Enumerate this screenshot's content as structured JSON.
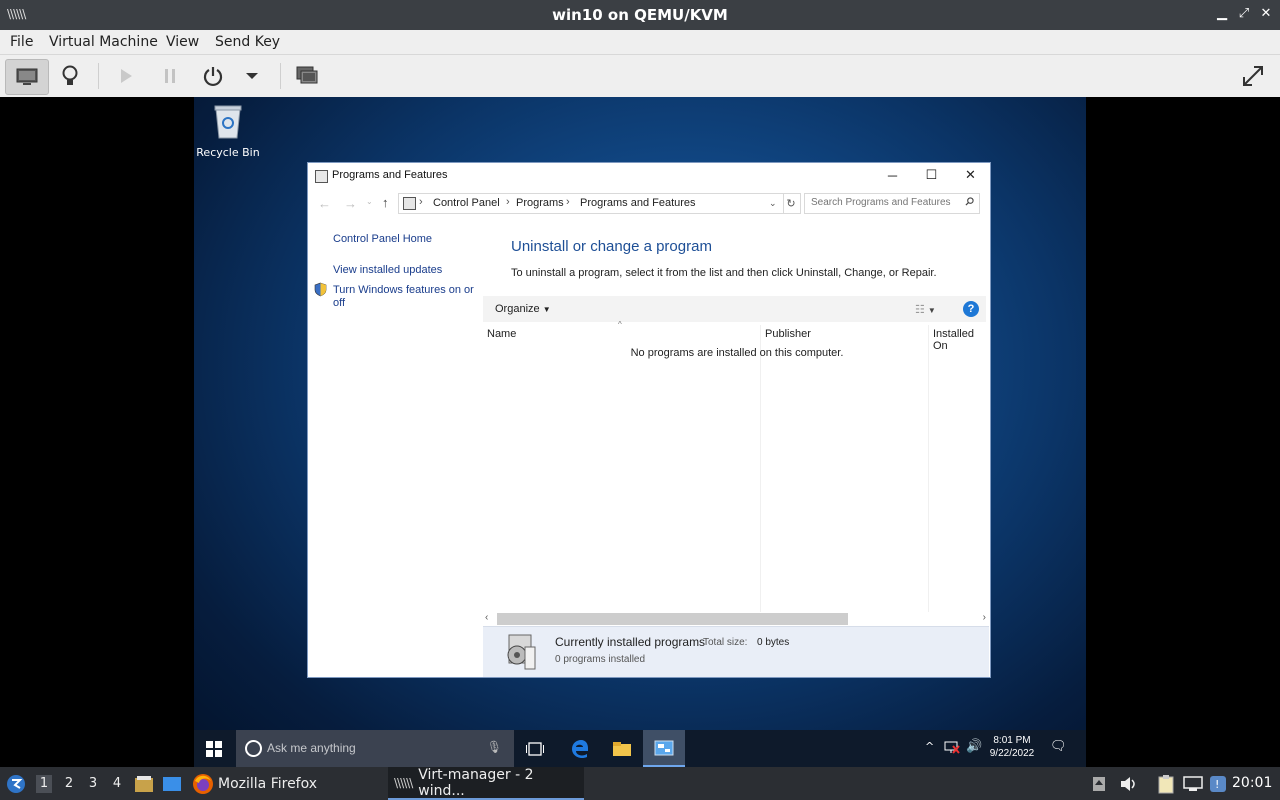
{
  "host": {
    "title": "win10 on QEMU/KVM",
    "menu": [
      "File",
      "Virtual Machine",
      "View",
      "Send Key"
    ]
  },
  "desktop": {
    "recycle_bin_label": "Recycle Bin"
  },
  "window": {
    "title": "Programs and Features",
    "breadcrumb": [
      "Control Panel",
      "Programs",
      "Programs and Features"
    ],
    "search_placeholder": "Search Programs and Features",
    "sidebar": {
      "home": "Control Panel Home",
      "updates": "View installed updates",
      "features_line1": "Turn Windows features on or",
      "features_line2": "off"
    },
    "heading": "Uninstall or change a program",
    "description": "To uninstall a program, select it from the list and then click Uninstall, Change, or Repair.",
    "organize_label": "Organize",
    "columns": [
      "Name",
      "Publisher",
      "Installed On"
    ],
    "empty_message": "No programs are installed on this computer.",
    "details": {
      "title": "Currently installed programs",
      "size_label": "Total size:",
      "size_value": "0 bytes",
      "count": "0 programs installed"
    }
  },
  "guest_taskbar": {
    "search_placeholder": "Ask me anything",
    "time": "8:01 PM",
    "date": "9/22/2022"
  },
  "panel": {
    "workspaces": [
      "1",
      "2",
      "3",
      "4"
    ],
    "tasks": [
      "Mozilla Firefox",
      "Virt-manager - 2 wind..."
    ],
    "clock": "20:01"
  },
  "colors": {
    "link": "#1a3d8c",
    "heading": "#1e4f96",
    "help": "#1e78d6"
  }
}
